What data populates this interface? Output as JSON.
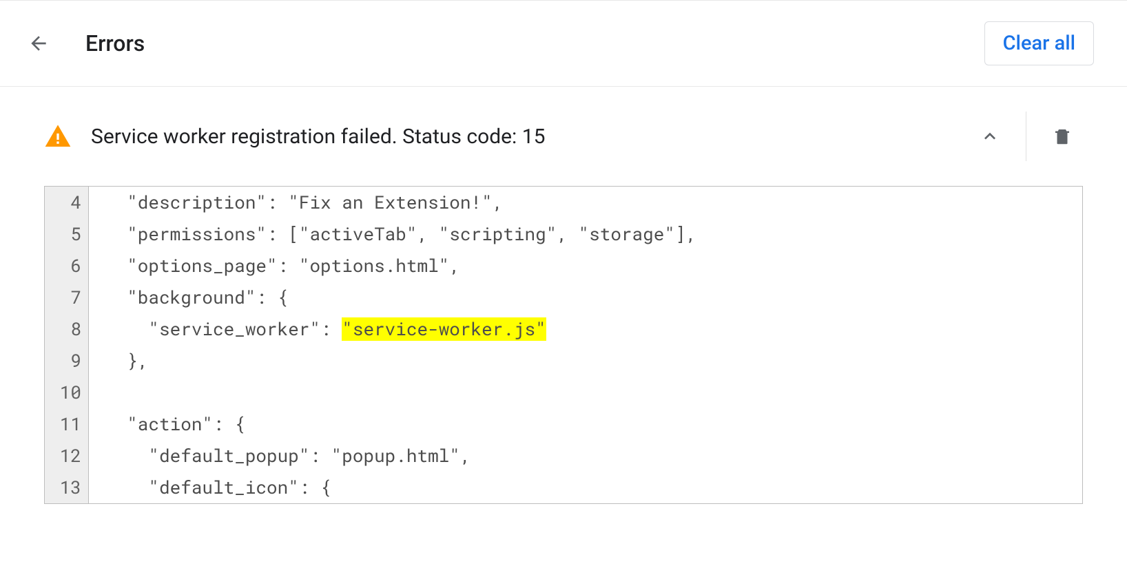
{
  "header": {
    "title": "Errors",
    "clear_all_label": "Clear all"
  },
  "error": {
    "message": "Service worker registration failed. Status code: 15"
  },
  "code": {
    "lines": [
      {
        "num": "4",
        "indent": "  ",
        "text": "\"description\": \"Fix an Extension!\","
      },
      {
        "num": "5",
        "indent": "  ",
        "text": "\"permissions\": [\"activeTab\", \"scripting\", \"storage\"],"
      },
      {
        "num": "6",
        "indent": "  ",
        "text": "\"options_page\": \"options.html\","
      },
      {
        "num": "7",
        "indent": "  ",
        "text": "\"background\": {"
      },
      {
        "num": "8",
        "indent": "    ",
        "prefix": "\"service_worker\": ",
        "highlight": "\"service-worker.js\"",
        "suffix": ""
      },
      {
        "num": "9",
        "indent": "  ",
        "text": "},"
      },
      {
        "num": "10",
        "indent": "",
        "text": ""
      },
      {
        "num": "11",
        "indent": "  ",
        "text": "\"action\": {"
      },
      {
        "num": "12",
        "indent": "    ",
        "text": "\"default_popup\": \"popup.html\","
      },
      {
        "num": "13",
        "indent": "    ",
        "text": "\"default_icon\": {"
      }
    ]
  }
}
